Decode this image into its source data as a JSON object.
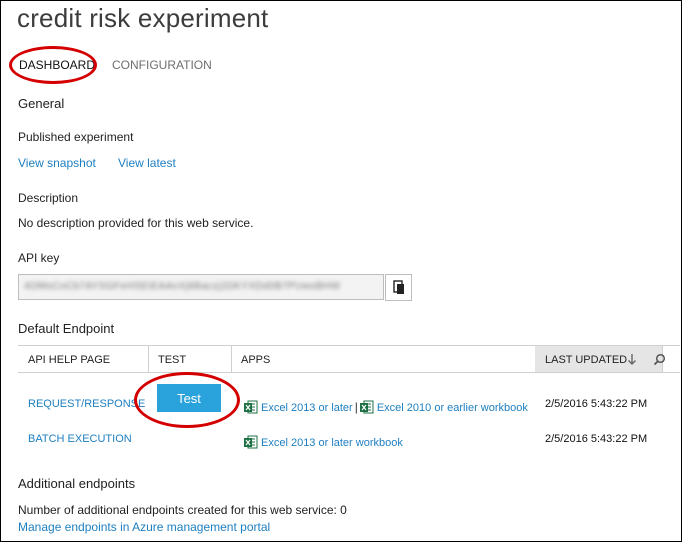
{
  "page_title": "credit risk experiment",
  "tabs": [
    {
      "label": "DASHBOARD"
    },
    {
      "label": "CONFIGURATION"
    }
  ],
  "general": {
    "heading": "General",
    "published_label": "Published experiment",
    "view_snapshot": "View snapshot",
    "view_latest": "View latest",
    "description_label": "Description",
    "description_text": "No description provided for this web service.",
    "api_key_label": "API key",
    "api_key_value": "4OMsCoCb7AYSGFeHSEIEAAnXj6Baczj2DKYXDd0B7PUwsBHW"
  },
  "default_endpoint": {
    "heading": "Default Endpoint",
    "columns": {
      "api_help": "API HELP PAGE",
      "test": "TEST",
      "apps": "APPS",
      "last_updated": "LAST UPDATED"
    },
    "rows": [
      {
        "api_help": "REQUEST/RESPONSE",
        "test_label": "Test",
        "app1": "Excel 2013 or later",
        "separator": "|",
        "app2": "Excel 2010 or earlier workbook",
        "updated": "2/5/2016 5:43:22 PM"
      },
      {
        "api_help": "BATCH EXECUTION",
        "app1": "Excel 2013 or later workbook",
        "updated": "2/5/2016 5:43:22 PM"
      }
    ]
  },
  "additional": {
    "heading": "Additional endpoints",
    "count_text": "Number of additional endpoints created for this web service: 0",
    "manage_link": "Manage endpoints in Azure management portal"
  },
  "colors": {
    "link": "#1e7fc1",
    "test_button": "#2aa3dd",
    "highlight_oval": "#d40000",
    "excel_green": "#1d7044"
  },
  "icons": [
    "copy-icon",
    "sort-down-arrow-icon",
    "search-icon",
    "excel-icon"
  ]
}
